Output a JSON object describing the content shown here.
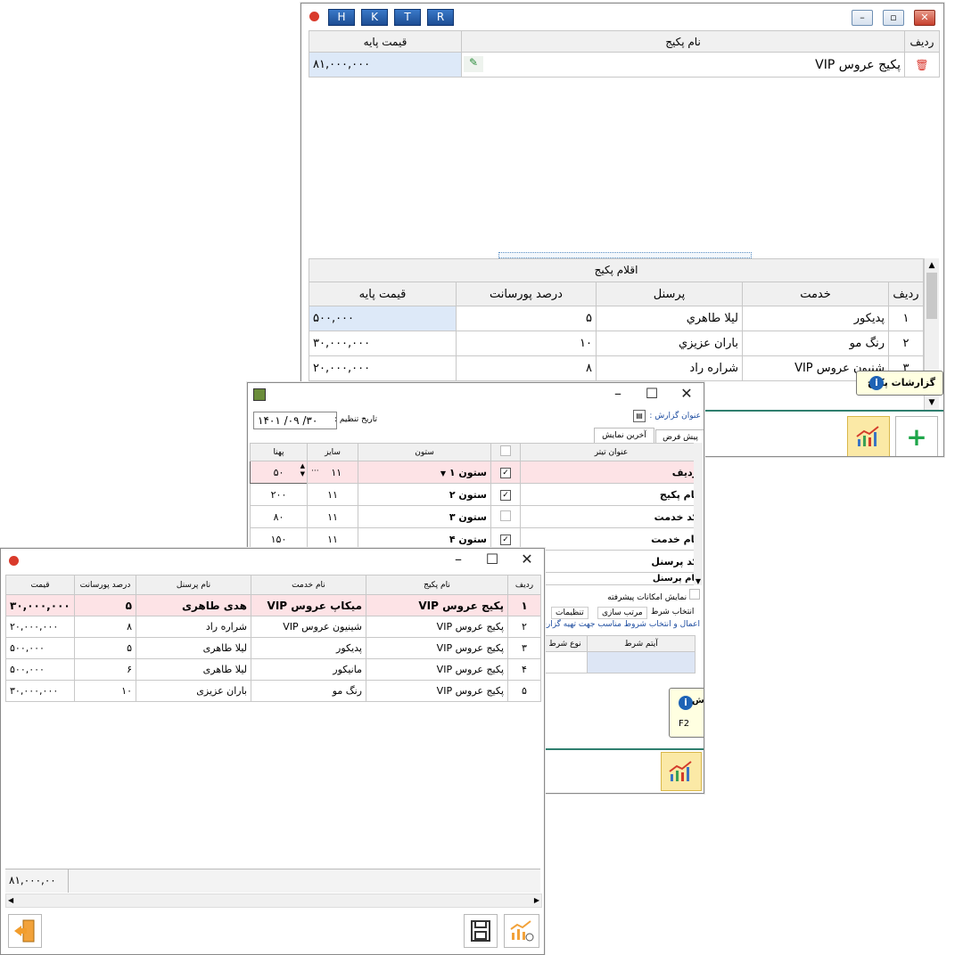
{
  "package_window": {
    "letters": [
      "H",
      "K",
      "T",
      "R"
    ],
    "top_table": {
      "headers": {
        "row": "ردیف",
        "name": "نام پکیج",
        "price": "قیمت پایه"
      },
      "rows": [
        {
          "name": "پکیج عروس VIP",
          "price": "۸۱,۰۰۰,۰۰۰"
        }
      ]
    },
    "items": {
      "caption": "اقلام پکیج",
      "headers": {
        "row": "ردیف",
        "service": "خدمت",
        "staff": "پرسنل",
        "percent": "درصد پورسانت",
        "price": "قیمت پایه"
      },
      "rows": [
        {
          "row": "۱",
          "service": "پدیکور",
          "staff": "ليلا طاهري",
          "percent": "۵",
          "price": "۵۰۰,۰۰۰"
        },
        {
          "row": "۲",
          "service": "رنگ مو",
          "staff": "باران عزيزي",
          "percent": "۱۰",
          "price": "۳۰,۰۰۰,۰۰۰"
        },
        {
          "row": "۳",
          "service": "شنیون عروس VIP",
          "staff": "شراره راد",
          "percent": "۸",
          "price": "۲۰,۰۰۰,۰۰۰"
        }
      ]
    },
    "tooltip": "گزارشات پکیج"
  },
  "report_window": {
    "date_label": "تاریخ تنظیم :",
    "date_value": "۱۴۰۱ /۰۹ /۳۰",
    "title_label": "عنوان گزارش :",
    "tabs": [
      "پیش فرض",
      "آخرین نمایش"
    ],
    "headers": {
      "title": "عنوان تیتر",
      "column": "ستون",
      "size": "سایز",
      "width": "پهنا"
    },
    "rows": [
      {
        "title": "ردیف",
        "checked": true,
        "column": "ستون ۱",
        "size": "۱۱",
        "width": "۵۰"
      },
      {
        "title": "نام پکیج",
        "checked": true,
        "column": "ستون ۲",
        "size": "۱۱",
        "width": "۲۰۰"
      },
      {
        "title": "کد خدمت",
        "checked": false,
        "column": "ستون ۳",
        "size": "۱۱",
        "width": "۸۰"
      },
      {
        "title": "نام خدمت",
        "checked": true,
        "column": "ستون ۴",
        "size": "۱۱",
        "width": "۱۵۰"
      },
      {
        "title": "کد پرسنل",
        "checked": false,
        "column": "",
        "size": "",
        "width": ""
      },
      {
        "title": "نام پرسنل",
        "checked": false,
        "column": "",
        "size": "",
        "width": ""
      }
    ],
    "advanced": "نمایش امکانات پیشرفته",
    "section_tabs": [
      "انتخاب شرط",
      "مرتب سازی",
      "تنظیمات"
    ],
    "condition_hint": "اعمال و انتخاب شروط مناسب جهت تهیه گزارش",
    "condition_headers": {
      "item": "آیتم شرط",
      "type": "نوع شرط"
    },
    "tooltip": {
      "title": "تهیه گزارش",
      "key": "F2"
    }
  },
  "result_window": {
    "headers": {
      "row": "ردیف",
      "package": "نام پکیج",
      "service": "نام خدمت",
      "staff": "نام پرسنل",
      "percent": "درصد پورسانت",
      "price": "قیمت"
    },
    "rows": [
      {
        "row": "۱",
        "package": "پکیج عروس VIP",
        "service": "میکاپ عروس VIP",
        "staff": "هدی طاهری",
        "percent": "۵",
        "price": "۳۰,۰۰۰,۰۰۰"
      },
      {
        "row": "۲",
        "package": "پکیج عروس VIP",
        "service": "شینیون عروس VIP",
        "staff": "شراره راد",
        "percent": "۸",
        "price": "۲۰,۰۰۰,۰۰۰"
      },
      {
        "row": "۳",
        "package": "پکیج عروس VIP",
        "service": "پدیکور",
        "staff": "لیلا طاهری",
        "percent": "۵",
        "price": "۵۰۰,۰۰۰"
      },
      {
        "row": "۴",
        "package": "پکیج عروس VIP",
        "service": "مانیکور",
        "staff": "لیلا طاهری",
        "percent": "۶",
        "price": "۵۰۰,۰۰۰"
      },
      {
        "row": "۵",
        "package": "پکیج عروس VIP",
        "service": "رنگ مو",
        "staff": "باران عزیزی",
        "percent": "۱۰",
        "price": "۳۰,۰۰۰,۰۰۰"
      }
    ],
    "total": "۸۱,۰۰۰,۰۰"
  }
}
